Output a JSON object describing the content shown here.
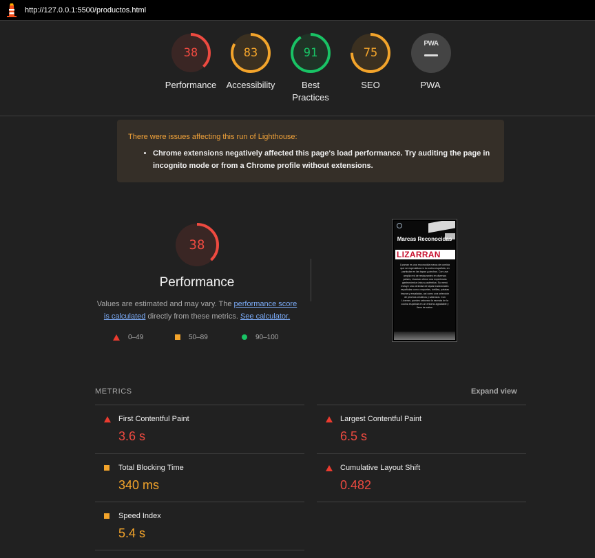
{
  "browser": {
    "url": "http://127.0.0.1:5500/productos.html"
  },
  "gauges": [
    {
      "id": "performance",
      "score": "38",
      "label": "Performance",
      "fraction": 0.38,
      "color": "#ee4a40",
      "bg": "#3a2624"
    },
    {
      "id": "accessibility",
      "score": "83",
      "label": "Accessibility",
      "fraction": 0.83,
      "color": "#f3a42b",
      "bg": "#3b3020"
    },
    {
      "id": "best-practices",
      "score": "91",
      "label": "Best Practices",
      "fraction": 0.91,
      "color": "#19c365",
      "bg": "#1f3326"
    },
    {
      "id": "seo",
      "score": "75",
      "label": "SEO",
      "fraction": 0.75,
      "color": "#f3a42b",
      "bg": "#3b3020"
    }
  ],
  "pwa": {
    "badge": "PWA",
    "label": "PWA"
  },
  "warning": {
    "title": "There were issues affecting this run of Lighthouse:",
    "items": [
      "Chrome extensions negatively affected this page's load performance. Try auditing the page in incognito mode or from a Chrome profile without extensions."
    ]
  },
  "performance": {
    "score": "38",
    "fraction": 0.38,
    "title": "Performance",
    "desc_prefix": "Values are estimated and may vary. The ",
    "desc_link1": "performance score is calculated",
    "desc_middle": " directly from these metrics. ",
    "desc_link2": "See calculator."
  },
  "legend": {
    "fail": "0–49",
    "average": "50–89",
    "pass": "90–100"
  },
  "screenshot": {
    "heading": "Marcas Reconocidas",
    "brand": "LIZARRAN",
    "paragraph": "Lizarran es una reconocida marca de comida que se especializa en la cocina española, en particular en las tapas y pinchos. Con una amplia red de restaurantes en diversos países, Lizarran ofrece una experiencia gastronómica única y auténtica. Su menú incluye una variedad de tapas tradicionales españolas como croquetas, tortillas, patatas bravas y ensaladas, así como una selección de pinchos creativos y sabrosos. Con Lizarran, puedes saborear la esencia de la cocina española en un entorno agradable y lleno de sabor."
  },
  "metrics": {
    "heading": "METRICS",
    "expand": "Expand view",
    "left": [
      {
        "name": "First Contentful Paint",
        "value": "3.6 s",
        "rating": "fail"
      },
      {
        "name": "Total Blocking Time",
        "value": "340 ms",
        "rating": "average"
      },
      {
        "name": "Speed Index",
        "value": "5.4 s",
        "rating": "average"
      }
    ],
    "right": [
      {
        "name": "Largest Contentful Paint",
        "value": "6.5 s",
        "rating": "fail"
      },
      {
        "name": "Cumulative Layout Shift",
        "value": "0.482",
        "rating": "fail"
      }
    ]
  }
}
